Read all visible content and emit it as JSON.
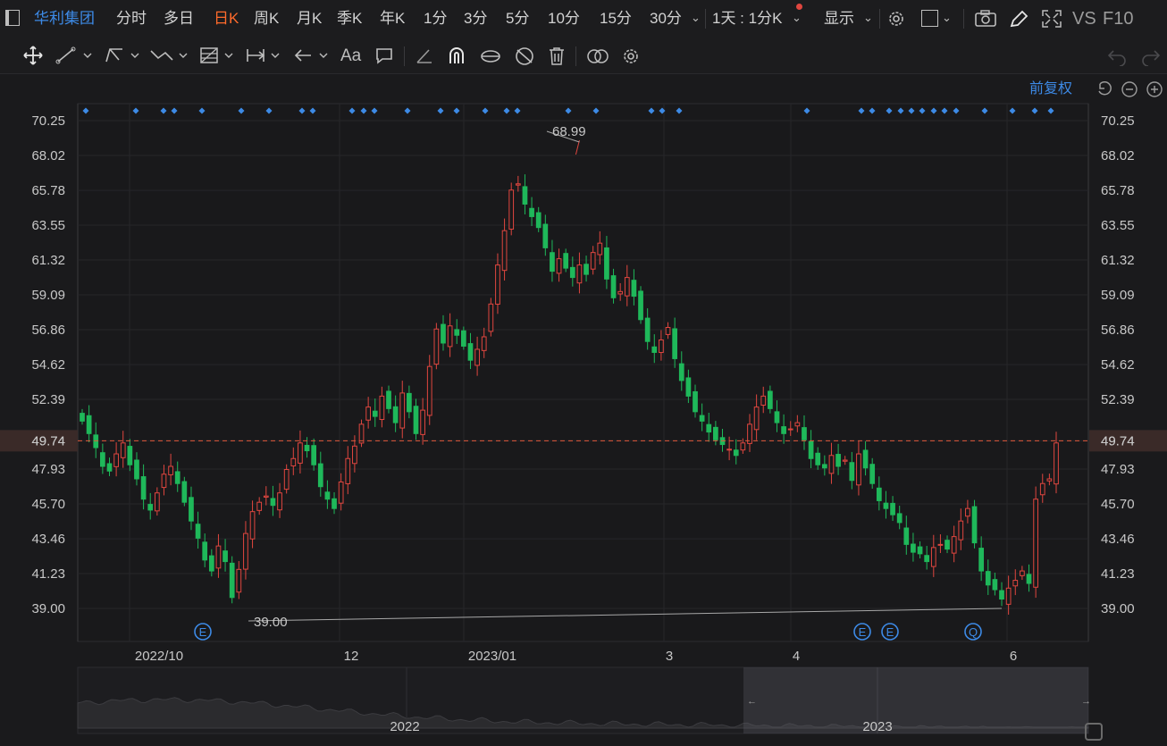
{
  "topbar": {
    "stock_name": "华利集团",
    "periods": [
      "分时",
      "多日",
      "日K",
      "周K",
      "月K",
      "季K",
      "年K",
      "1分",
      "3分",
      "5分",
      "10分",
      "15分",
      "30分"
    ],
    "active_period": "日K",
    "interval_select": "1天 : 1分K",
    "display_label": "显示",
    "vs_label": "VS",
    "f10_label": "F10"
  },
  "panel": {
    "adjust_label": "前复权"
  },
  "colors": {
    "up": "#e0463f",
    "down": "#1fb85a",
    "accent": "#ff6a2b",
    "blue": "#3d8ae6",
    "price_line": "#e15a3b"
  },
  "chart_data": {
    "type": "candlestick",
    "y_ticks": [
      "70.25",
      "68.02",
      "65.78",
      "63.55",
      "61.32",
      "59.09",
      "56.86",
      "54.62",
      "52.39",
      "49.74",
      "47.93",
      "45.70",
      "43.46",
      "41.23",
      "39.00"
    ],
    "ylim": [
      39.0,
      70.25
    ],
    "x_ticks": [
      "2022/10",
      "12",
      "2023/01",
      "3",
      "4",
      "6"
    ],
    "current_price": "49.74",
    "max_label": "68.99",
    "min_label": "39.00",
    "event_markers": [
      "E",
      "E",
      "E",
      "Q"
    ],
    "navigator_labels": [
      "2022",
      "2023"
    ],
    "close_series": [
      51.0,
      50.2,
      49.3,
      48.1,
      47.8,
      48.9,
      49.6,
      48.2,
      47.3,
      46.0,
      45.3,
      46.4,
      47.6,
      48.1,
      47.0,
      45.8,
      44.6,
      43.5,
      42.1,
      41.4,
      43.0,
      42.0,
      39.7,
      41.5,
      43.8,
      45.2,
      45.8,
      46.2,
      45.6,
      46.4,
      47.9,
      48.6,
      49.6,
      49.1,
      48.2,
      46.8,
      46.0,
      45.4,
      47.1,
      48.6,
      49.4,
      50.8,
      51.9,
      51.3,
      52.6,
      51.8,
      50.9,
      52.8,
      51.6,
      50.2,
      51.7,
      54.5,
      56.9,
      56.0,
      57.1,
      56.5,
      55.8,
      54.9,
      55.6,
      56.4,
      58.5,
      61.0,
      63.2,
      65.8,
      66.2,
      64.9,
      64.1,
      63.4,
      62.1,
      60.6,
      61.4,
      60.8,
      60.2,
      61.0,
      60.4,
      61.8,
      62.4,
      60.1,
      58.9,
      59.3,
      60.2,
      59.0,
      57.5,
      56.1,
      55.4,
      56.2,
      57.0,
      55.0,
      53.6,
      52.6,
      51.6,
      51.0,
      50.3,
      49.8,
      49.5,
      49.2,
      48.8,
      49.6,
      50.8,
      51.9,
      52.6,
      51.8,
      50.9,
      50.2,
      50.5,
      50.9,
      49.8,
      48.6,
      48.2,
      48.0,
      48.8,
      48.1,
      48.5,
      47.2,
      48.9,
      48.0,
      47.0,
      45.9,
      45.4,
      45.0,
      44.5,
      43.1,
      42.6,
      42.5,
      42.0,
      42.9,
      43.1,
      42.8,
      43.6,
      44.6,
      45.4,
      43.2,
      41.4,
      40.5,
      40.2,
      39.6,
      40.3,
      40.8,
      41.4,
      40.6,
      46.0,
      47.0,
      47.3,
      49.6
    ]
  }
}
